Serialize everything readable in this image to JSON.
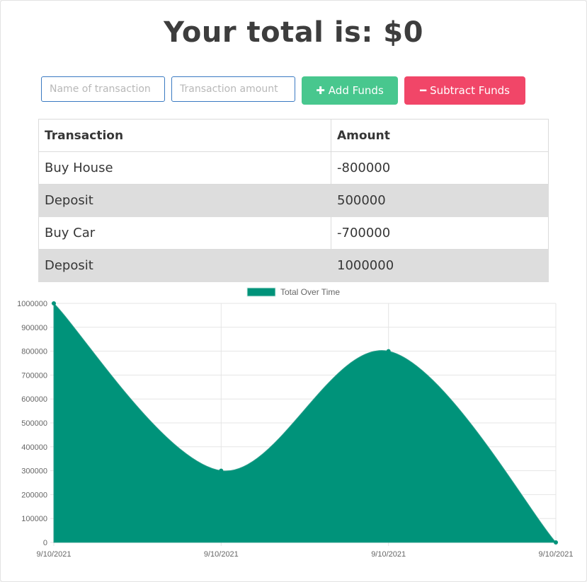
{
  "header": {
    "title": "Your total is: $0"
  },
  "form": {
    "name_placeholder": "Name of transaction",
    "amount_placeholder": "Transaction amount",
    "add_label": "Add Funds",
    "subtract_label": "Subtract Funds",
    "add_icon": "plus-icon",
    "subtract_icon": "minus-icon"
  },
  "colors": {
    "add": "#48c78e",
    "subtract": "#f14668",
    "chart_fill": "#00937a"
  },
  "table": {
    "headers": [
      "Transaction",
      "Amount"
    ],
    "rows": [
      [
        "Buy House",
        "-800000"
      ],
      [
        "Deposit",
        "500000"
      ],
      [
        "Buy Car",
        "-700000"
      ],
      [
        "Deposit",
        "1000000"
      ]
    ]
  },
  "chart_data": {
    "type": "area",
    "x": [
      "9/10/2021",
      "9/10/2021",
      "9/10/2021",
      "9/10/2021"
    ],
    "series": [
      {
        "name": "Total Over Time",
        "values": [
          1000000,
          300000,
          800000,
          0
        ]
      }
    ],
    "ylim": [
      0,
      1000000
    ],
    "yticks": [
      0,
      100000,
      200000,
      300000,
      400000,
      500000,
      600000,
      700000,
      800000,
      900000,
      1000000
    ],
    "legend": "top",
    "grid": true
  }
}
